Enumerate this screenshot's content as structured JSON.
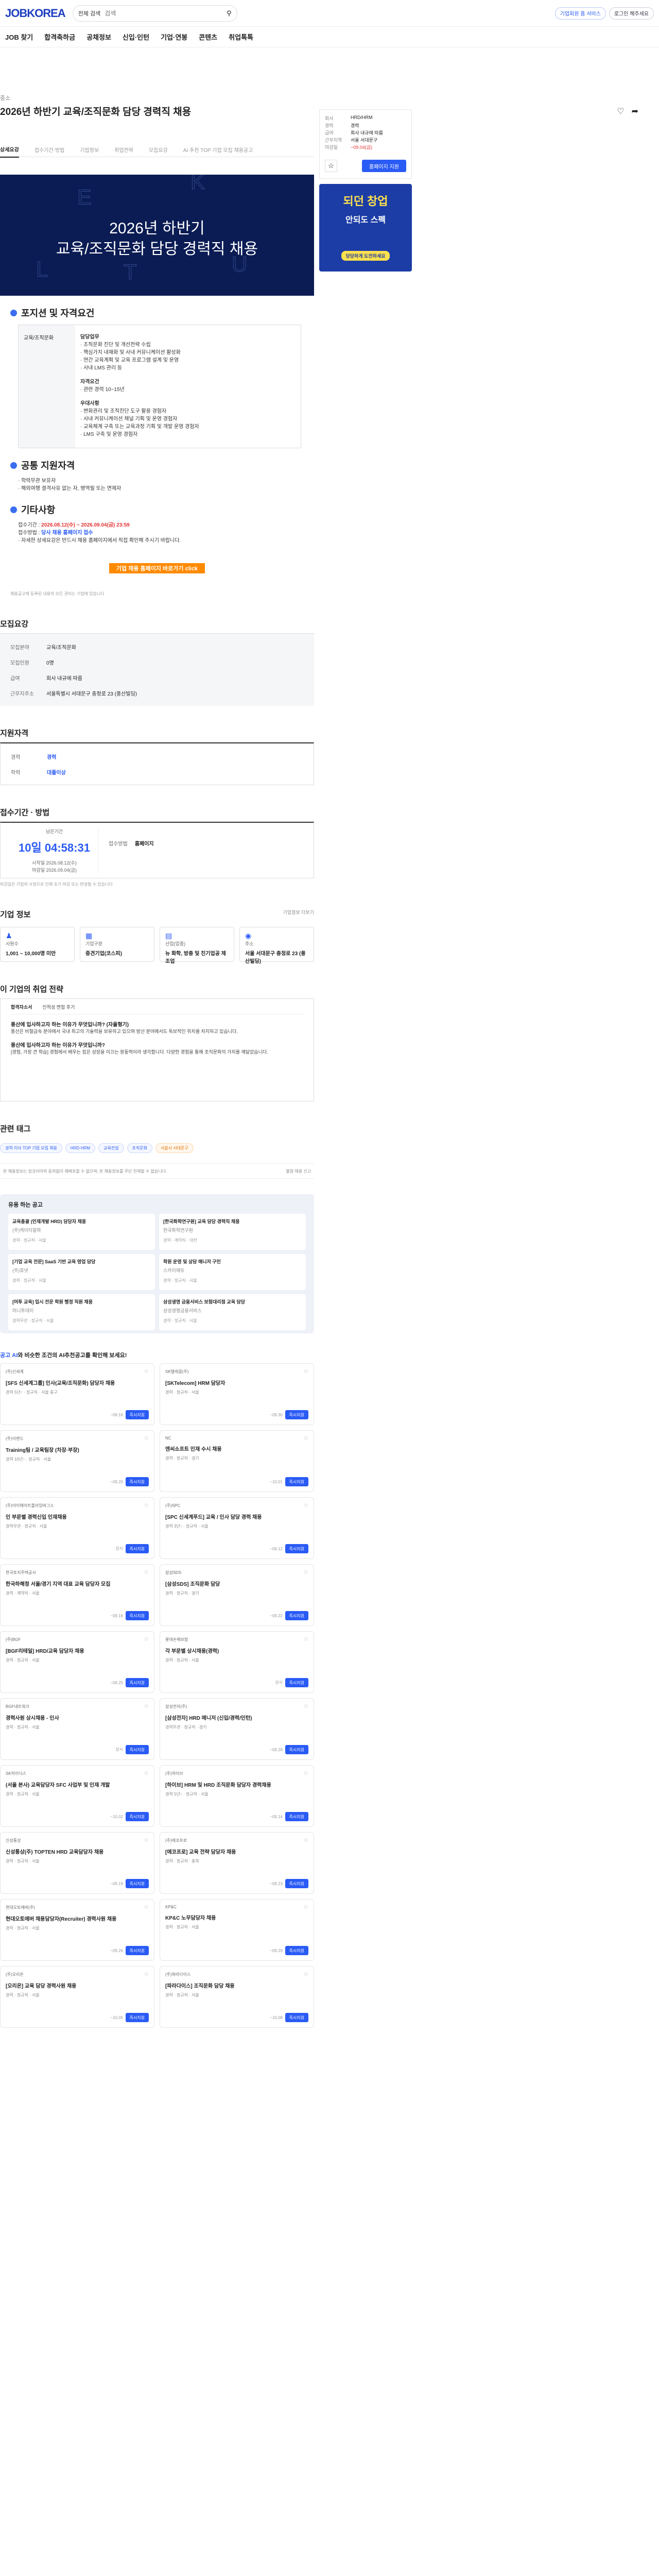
{
  "header": {
    "logo": "JOBKOREA",
    "search_scope": "전체 검색",
    "search_placeholder": "검색",
    "btn_corp": "기업회원 홈 서비스",
    "btn_login": "로그인 해주세요"
  },
  "gnb": [
    "JOB 찾기",
    "합격축하금",
    "공채정보",
    "신입·인턴",
    "기업·연봉",
    "콘텐츠",
    "취업톡톡"
  ],
  "job": {
    "category": "중소",
    "title": "2026년 하반기 교육/조직문화 담당 경력직 채용"
  },
  "tabs": [
    "상세요강",
    "접수기간·방법",
    "기업정보",
    "취업전략",
    "모집요강",
    "AI 추천 TOP 기업 모집 채용공고"
  ],
  "banner": {
    "line1": "2026년 하반기",
    "line2": "교육/조직문화 담당 경력직 채용",
    "letters": [
      "E",
      "K",
      "L",
      "T",
      "U"
    ]
  },
  "position": {
    "heading": "포지션 및 자격요건",
    "label": "교육/조직문화",
    "sections": [
      {
        "title": "담당업무",
        "items": [
          "· 조직문화 진단 및 개선전략 수립",
          "· 핵심가치 내재화 및 사내 커뮤니케이션 활성화",
          "· 연간 교육계획 및 교육 프로그램 설계 및 운영",
          "· 사내 LMS 관리 등"
        ]
      },
      {
        "title": "자격요건",
        "items": [
          "· 관련 경력 10~15년"
        ]
      },
      {
        "title": "우대사항",
        "items": [
          "· 변화관리 및 조직진단 도구 활용 경험자",
          "· 사내 커뮤니케이션 채널 기획 및 운영 경험자",
          "· 교육체계 구축 또는 교육과정 기획 및 개발 운영 경험자",
          "· LMS 구축 및 운영 경험자"
        ]
      }
    ]
  },
  "common": {
    "heading": "공통 지원자격",
    "items": [
      "· 학력무관 보유자",
      "· 해외여행 결격사유 없는 자, 병역필 또는 면제자"
    ]
  },
  "etc": {
    "heading": "기타사항",
    "period_label": "접수기간 :",
    "period": "2026.08.12(수) ~ 2026.09.04(금) 23:59",
    "method_label": "접수방법 :",
    "method": "당사 채용 홈페이지 접수",
    "note": "· 자세한 상세요강은 반드시 채용 홈페이지에서 직접 확인해 주시기 바랍니다.",
    "apply": "기업 채용 홈페이지 바로가기 click"
  },
  "foot_note": "채용공고에 등록된 내용의 모든 권리는 기업에 있습니다",
  "recruit": {
    "heading": "모집요강",
    "rows": [
      [
        "모집분야",
        "교육/조직문화"
      ],
      [
        "모집인원",
        "0명"
      ],
      [
        "급여",
        "회사 내규에 따름"
      ],
      [
        "근무지주소",
        "서울특별시 서대문구 충정로 23 (풍산빌딩)"
      ]
    ]
  },
  "qual": {
    "heading": "지원자격",
    "rows": [
      [
        "경력",
        "경력"
      ],
      [
        "학력",
        "대졸이상"
      ]
    ]
  },
  "period": {
    "heading": "접수기간 · 방법",
    "remain_label": "남은기간",
    "remain": "10일 04:58:31",
    "start_label": "시작일",
    "start": "2026.08.12(수)",
    "end_label": "마감일",
    "end": "2026.09.04(금)",
    "method_label": "접수방법",
    "method": "홈페이지",
    "note": "마감일은 기업의 사정으로 인해 조기 마감 또는 변경될 수 있습니다."
  },
  "company": {
    "heading": "기업 정보",
    "more": "기업정보 더보기",
    "cards": [
      [
        "사원수",
        "1,001 ~ 10,000명 미만"
      ],
      [
        "기업구분",
        "중견기업(코스피)"
      ],
      [
        "산업(업종)",
        "뉴 화학, 방충 및 친기업공 제조업"
      ],
      [
        "주소",
        "서울 서대문구 충정로 23 (풍산빌딩)"
      ]
    ]
  },
  "strategy": {
    "heading": "이 기업의 취업 전략",
    "tabs": [
      "합격자소서",
      "인적성 면접 후기"
    ],
    "q1": "풍산에 입사하고자 하는 이유가 무엇입니까? (자율형기)",
    "a1": "풍산은 비철금속 분야에서 국내 최고의 기술력을 보유하고 있으며 방산 분야에서도 독보적인 위치를 차지하고 있습니다.",
    "q2": "풍산에 입사하고자 하는 이유가 무엇입니까?",
    "a2": "[경험, 가장 큰 학습] 경험에서 배우는 힘은 성장을 이끄는 원동력이라 생각합니다. 다양한 경험을 통해 조직문화의 가치를 깨달았습니다."
  },
  "tags": {
    "items": [
      "경력 이사 TOP 기업 모집 채용",
      "HRD·HRM",
      "교육컨설",
      "조직문화",
      "서울시 서대문구"
    ]
  },
  "notice": {
    "text": "본 채용정보는 잡코리아의 동의없이 재배포할 수 없으며, 본 채용정보를 무단 전재할 수 없습니다.",
    "report": "불량 채용 신고"
  },
  "similar": {
    "heading": "유용 하는 공고",
    "items": [
      {
        "t": "교육총괄 (인재개발 HRD) 담당자 채용",
        "c": "(주)케이티알파",
        "k": "경력 · 정규직 · 서울"
      },
      {
        "t": "[한국화학연구원] 교육 담당 경력직 채용",
        "c": "한국화학연구원",
        "k": "경력 · 계약직 · 대전"
      },
      {
        "t": "[기업 교육 전문] SaaS 기반 교육 영업 담당",
        "c": "(주)휴넷",
        "k": "경력 · 정규직 · 서울"
      },
      {
        "t": "학원 운영 및 상담 매니저 구인",
        "c": "스카이에듀",
        "k": "경력 · 정규직 · 서울"
      },
      {
        "t": "[머투 교육] 입시 전문 학원 행정 직원 채용",
        "c": "머니투데이",
        "k": "경력무관 · 정규직 · 서울"
      },
      {
        "t": "삼성생명 금융서비스 보험대리점 교육 담당",
        "c": "삼성생명금융서비스",
        "k": "경력 · 정규직 · 서울"
      }
    ]
  },
  "ai": {
    "heading_pre": "",
    "heading_b": "공고 AI",
    "heading_post": "와 비슷한 조건의 AI추천공고를 확인해 보세요!",
    "apply": "즉시지원",
    "items": [
      {
        "co": "(주)신세계",
        "t": "[SFS 신세계그룹] 인사(교육/조직문화) 담당자 채용",
        "m": "경력 5년↑ · 정규직 · 서울 중구",
        "d": "~09.16"
      },
      {
        "co": "SK텔레콤(주)",
        "t": "[SKTelecom] HRM 담당자",
        "m": "경력 · 정규직 · 서울",
        "d": "~09.30"
      },
      {
        "co": "(주)이랜드",
        "t": "Training팀 / 교육팀장 (차장·부장)",
        "m": "경력 10년↑ · 정규직 · 서울",
        "d": "~09.20"
      },
      {
        "co": "NC",
        "t": "엔씨소프트 인재 수시 채용",
        "m": "경력 · 정규직 · 경기",
        "d": "~10.01"
      },
      {
        "co": "(주)아이헤이트플라잉버그스",
        "t": "인 부문별 경력신입 인재채용",
        "m": "경력무관 · 정규직 · 서울",
        "d": "상시"
      },
      {
        "co": "(주)SPC",
        "t": "[SPC 신세계푸드] 교육 / 인사 담당 경력 채용",
        "m": "경력 3년↑ · 정규직 · 서울",
        "d": "~09.12"
      },
      {
        "co": "한국토지주택공사",
        "t": "한국하해청 서울/경기 지역 대표 교육 담당자 모집",
        "m": "경력 · 계약직 · 서울",
        "d": "~09.18"
      },
      {
        "co": "삼성SDS",
        "t": "[삼성SDS] 조직문화 담당",
        "m": "경력 · 정규직 · 경기",
        "d": "~09.22"
      },
      {
        "co": "(주)BGF",
        "t": "[BGF리테일] HRD/교육 담당자 채용",
        "m": "경력 · 정규직 · 서울",
        "d": "~09.25"
      },
      {
        "co": "롯데손해보험",
        "t": "각 부문별 상시채용(경력)",
        "m": "경력 · 정규직 · 서울",
        "d": "상시"
      },
      {
        "co": "BGF네트워크",
        "t": "경력사원 상시채용 - 인사",
        "m": "경력 · 정규직 · 서울",
        "d": "상시"
      },
      {
        "co": "삼성전자(주)",
        "t": "[삼성전자] HRD 매니저 (신입/경력/인턴)",
        "m": "경력무관 · 정규직 · 경기",
        "d": "~09.28"
      },
      {
        "co": "SK하이닉스",
        "t": "(서울 본사) 교육담당자 SFC 사업부 및 인재 개발",
        "m": "경력 · 정규직 · 서울",
        "d": "~10.02"
      },
      {
        "co": "(주)하이브",
        "t": "[하이브] HRM 및 HRD 조직문화 담당자 경력채용",
        "m": "경력 5년↑ · 정규직 · 서울",
        "d": "~09.14"
      },
      {
        "co": "신성통상",
        "t": "신성통상(주) TOPTEN HRD 교육담당자 채용",
        "m": "경력 · 정규직 · 서울",
        "d": "~09.19"
      },
      {
        "co": "(주)에코프로",
        "t": "[에코프로] 교육 전략 담당자 채용",
        "m": "경력 · 정규직 · 충북",
        "d": "~09.23"
      },
      {
        "co": "현대오토에버(주)",
        "t": "현대오토에버 채용담당자(Recruiter) 경력사원 채용",
        "m": "경력 · 정규직 · 서울",
        "d": "~09.26"
      },
      {
        "co": "KP&C",
        "t": "KP&C 노무담당자 채용",
        "m": "경력 · 정규직 · 서울",
        "d": "~09.29"
      },
      {
        "co": "(주)오리온",
        "t": "[오리온] 교육 담당 경력사원 채용",
        "m": "경력 · 정규직 · 서울",
        "d": "~10.05"
      },
      {
        "co": "(주)파라다이스",
        "t": "[파라다이스] 조직문화 담당 채용",
        "m": "경력 · 정규직 · 서울",
        "d": "~10.08"
      }
    ]
  },
  "side": {
    "rows": [
      [
        "회사",
        "HRD/HRM"
      ],
      [
        "경력",
        "경력"
      ],
      [
        "급여",
        "회사 내규에 따름"
      ],
      [
        "근무지역",
        "서울 서대문구"
      ],
      [
        "마감일",
        "~09.04(금)"
      ]
    ],
    "apply": "홈페이지 지원",
    "ad_1": "되던 창업",
    "ad_2": "안되도 스펙",
    "ad_3": "당당하게 도전하세요"
  },
  "colors": {
    "brand": "#1f3fbf",
    "accent": "#2a5bf5",
    "banner": "#0b1c54",
    "cta": "#ff8a00"
  }
}
